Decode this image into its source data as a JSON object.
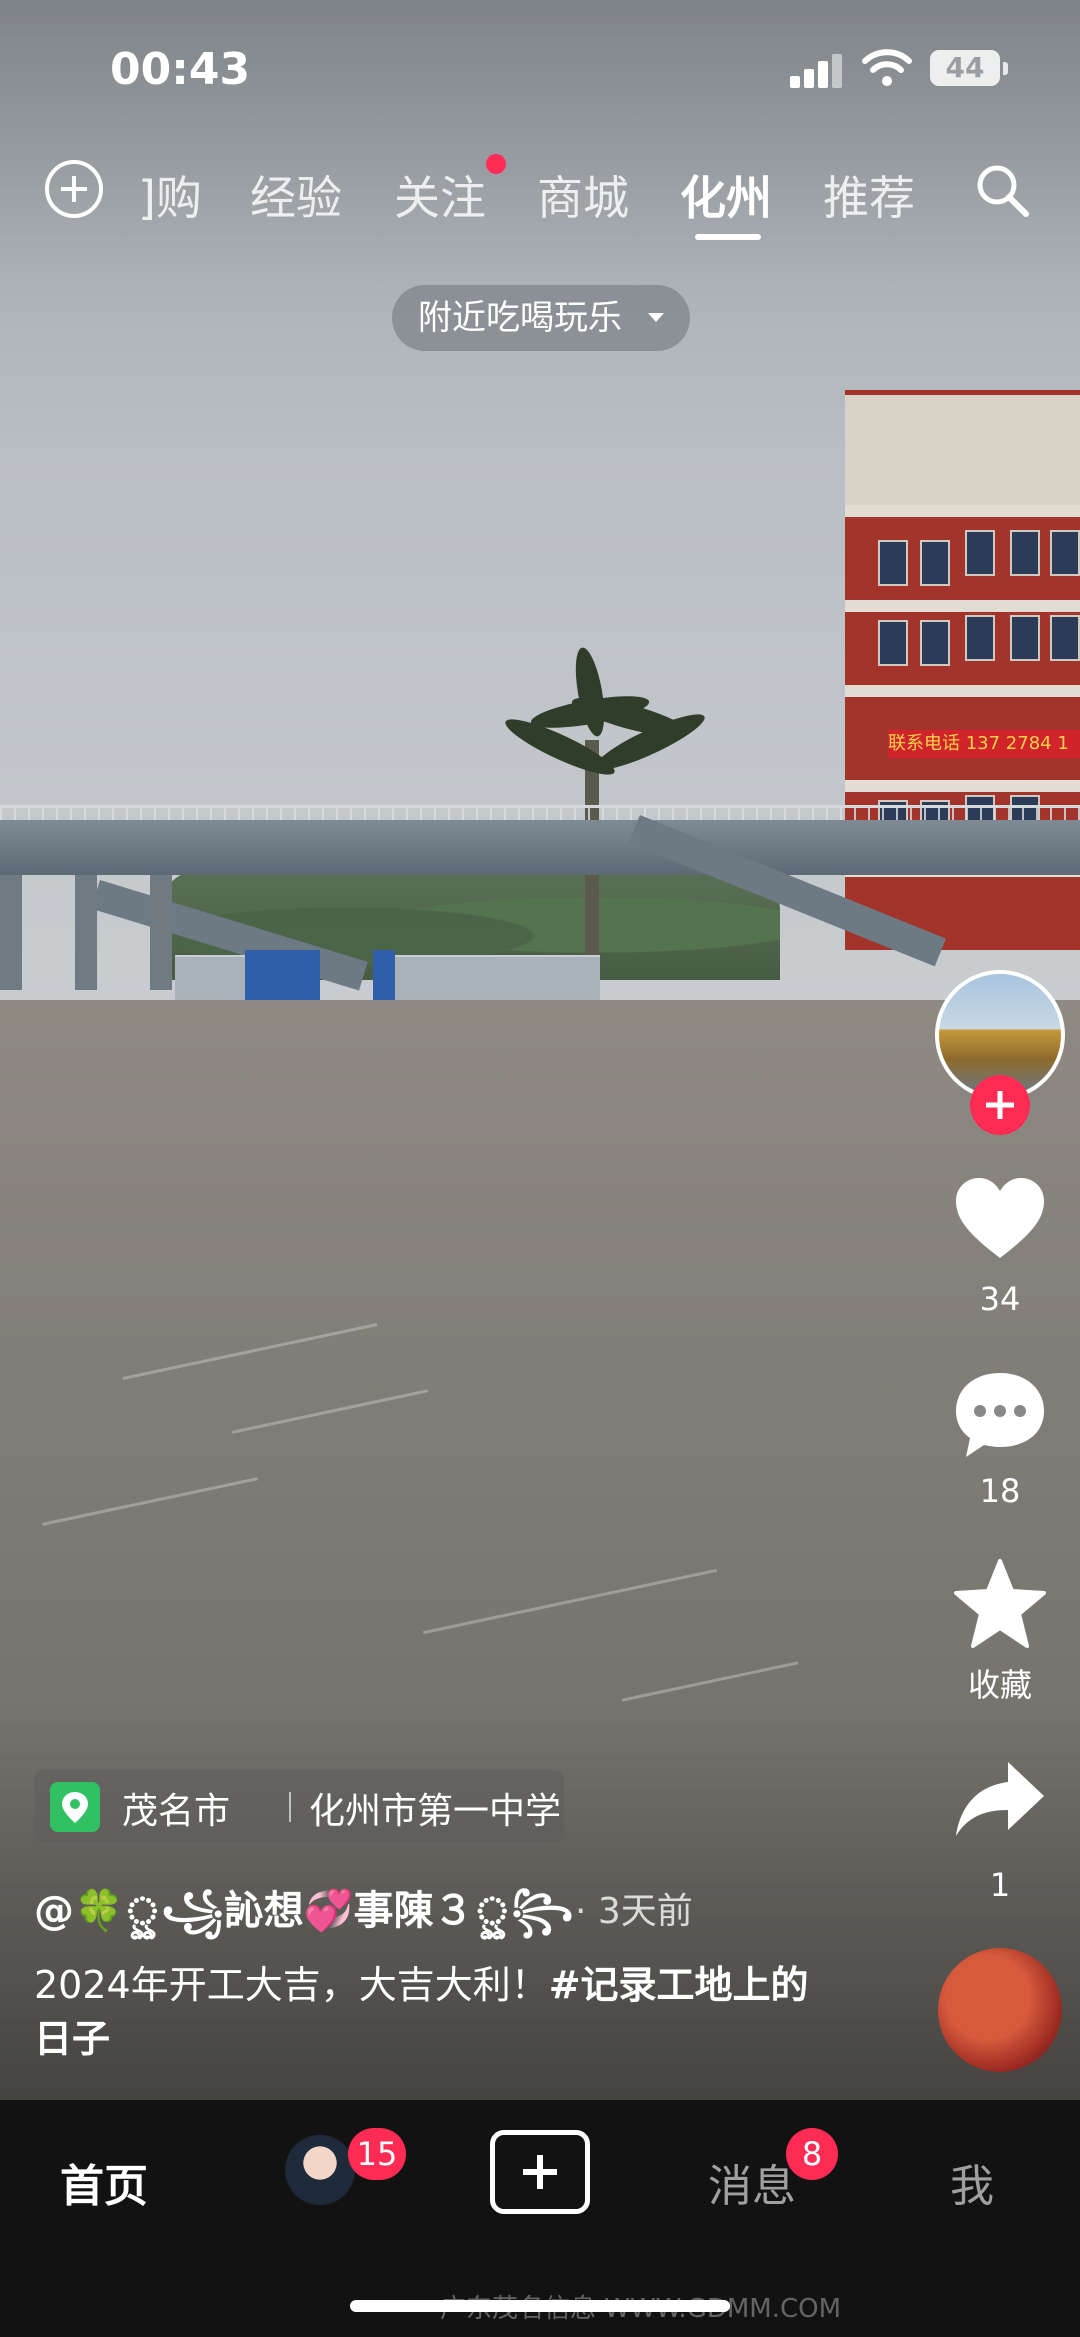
{
  "status_bar": {
    "time": "00:43",
    "battery": "44"
  },
  "top_tabs": {
    "items": [
      "]购",
      "经验",
      "关注",
      "商城",
      "化州",
      "推荐"
    ],
    "active": "化州"
  },
  "nearby_filter": {
    "label": "附近吃喝玩乐"
  },
  "actions": {
    "likes": "34",
    "comments": "18",
    "favorite_label": "收藏",
    "shares": "1"
  },
  "location": {
    "city": "茂名市",
    "place": "化州市第一中学"
  },
  "post": {
    "author": "@🍀ৣ꧁訫想💞事陳３ৣ꧂",
    "time": "· 3天前",
    "caption_text": "2024年开工大吉，大吉大利！",
    "caption_tag": "#记录工地上的日子"
  },
  "scene": {
    "banner_text": "联系电话 137 2784 1"
  },
  "bottom_nav": {
    "home": "首页",
    "friends_badge": "15",
    "messages": "消息",
    "messages_badge": "8",
    "me": "我"
  },
  "watermark": "广东茂名信息 WWW.GDMM.COM",
  "colors": {
    "accent": "#fe2c55",
    "location_green": "#31c164",
    "nav_bg": "#121212"
  }
}
